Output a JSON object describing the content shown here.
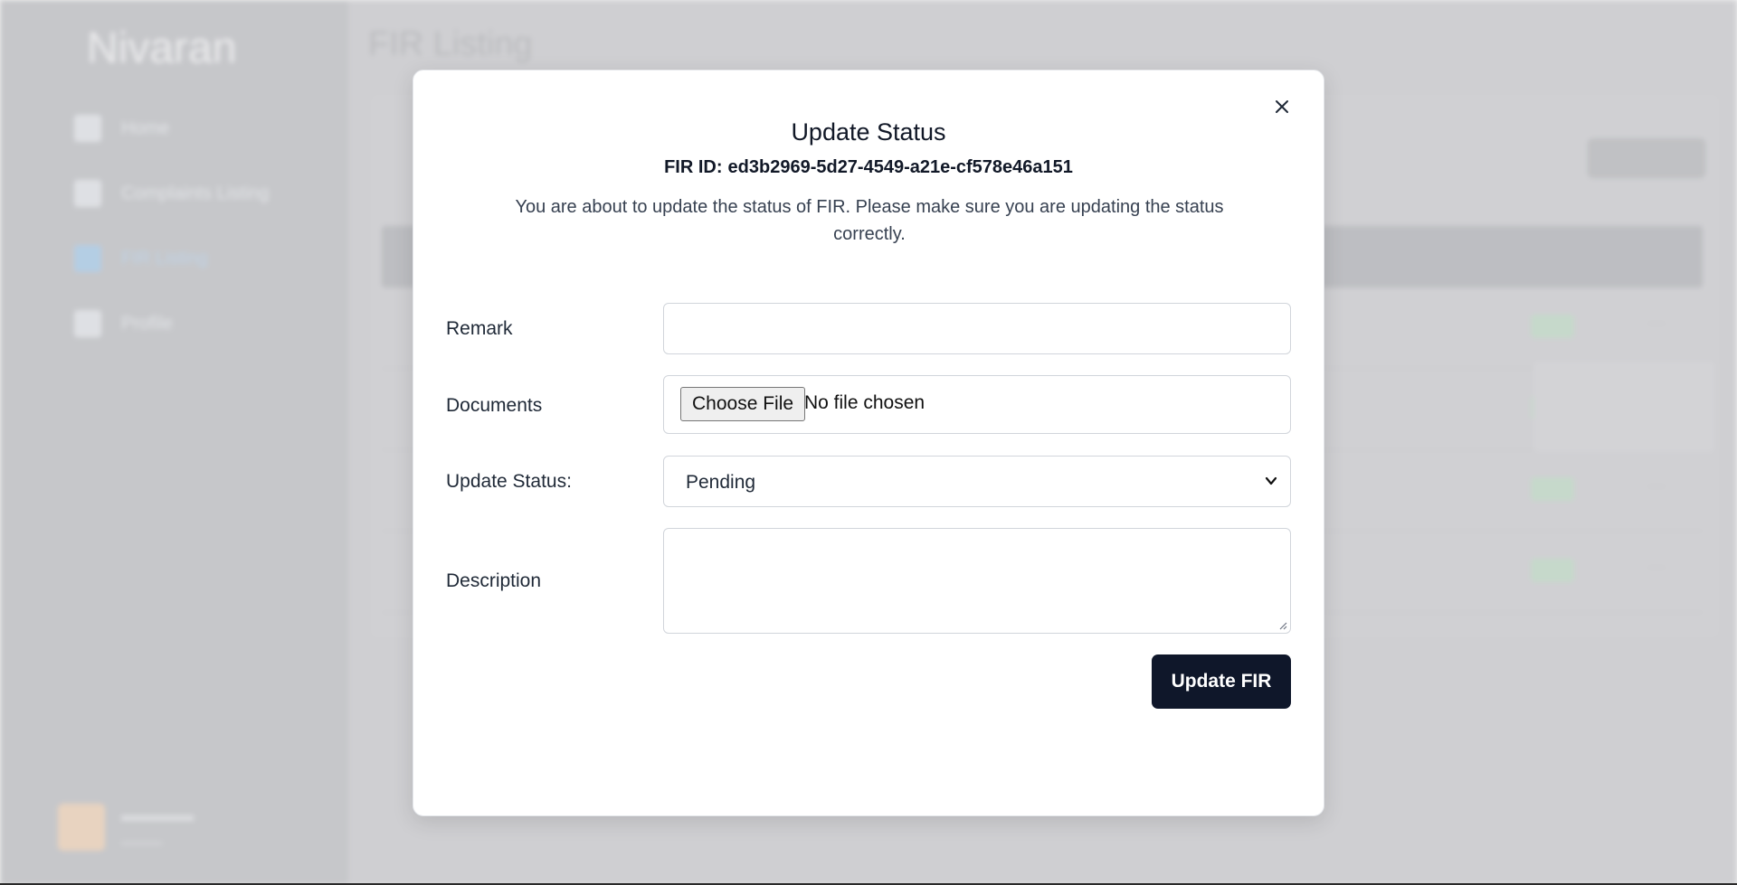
{
  "background": {
    "brand": "Nivaran",
    "nav": [
      {
        "label": "Home",
        "icon": "grid-icon"
      },
      {
        "label": "Complaints Listing",
        "icon": "clipboard-icon"
      },
      {
        "label": "FIR Listing",
        "icon": "document-icon"
      },
      {
        "label": "Profile",
        "icon": "user-icon"
      }
    ],
    "page_title": "FIR Listing"
  },
  "modal": {
    "title": "Update Status",
    "fir_id_label": "FIR ID:",
    "fir_id_value": "ed3b2969-5d27-4549-a21e-cf578e46a151",
    "description": "You are about to update the status of FIR. Please make sure you are updating the status correctly.",
    "fields": {
      "remark_label": "Remark",
      "remark_value": "",
      "documents_label": "Documents",
      "file_button": "Choose File",
      "file_status": "No file chosen",
      "status_label": "Update Status:",
      "status_value": "Pending",
      "description_label": "Description",
      "description_value": ""
    },
    "submit_label": "Update FIR"
  },
  "colors": {
    "primary_button": "#0f172a",
    "sidebar_bg": "#cfd0d3",
    "text_dark": "#111827"
  }
}
